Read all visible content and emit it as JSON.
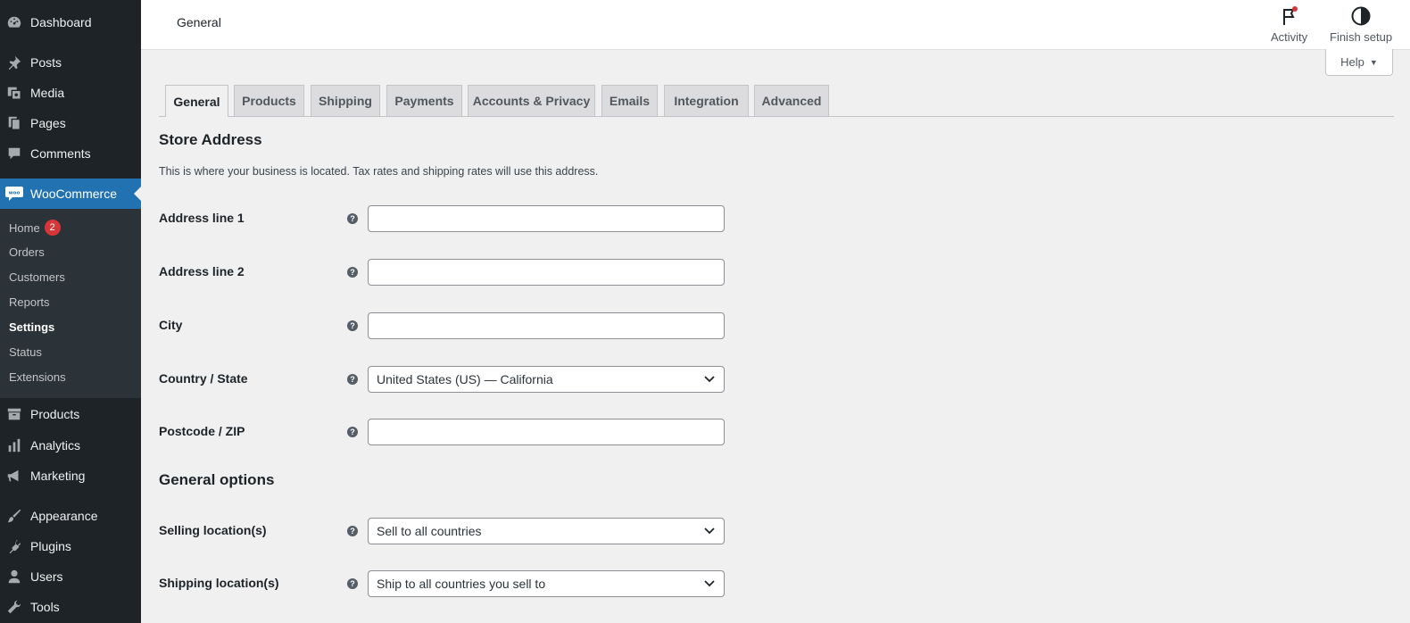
{
  "sidebar": {
    "items": [
      {
        "label": "Dashboard",
        "icon": "dashboard-icon"
      },
      {
        "label": "Posts",
        "icon": "pin-icon"
      },
      {
        "label": "Media",
        "icon": "media-icon"
      },
      {
        "label": "Pages",
        "icon": "pages-icon"
      },
      {
        "label": "Comments",
        "icon": "comment-icon"
      },
      {
        "label": "WooCommerce",
        "icon": "woo-icon"
      },
      {
        "label": "Products",
        "icon": "archive-icon"
      },
      {
        "label": "Analytics",
        "icon": "bar-chart-icon"
      },
      {
        "label": "Marketing",
        "icon": "megaphone-icon"
      },
      {
        "label": "Appearance",
        "icon": "brush-icon"
      },
      {
        "label": "Plugins",
        "icon": "plug-icon"
      },
      {
        "label": "Users",
        "icon": "user-icon"
      },
      {
        "label": "Tools",
        "icon": "wrench-icon"
      }
    ],
    "woo_submenu": [
      {
        "label": "Home",
        "badge": "2"
      },
      {
        "label": "Orders"
      },
      {
        "label": "Customers"
      },
      {
        "label": "Reports"
      },
      {
        "label": "Settings"
      },
      {
        "label": "Status"
      },
      {
        "label": "Extensions"
      }
    ]
  },
  "header": {
    "title": "General",
    "activity_label": "Activity",
    "finish_setup_label": "Finish setup",
    "help_label": "Help"
  },
  "tabs": [
    "General",
    "Products",
    "Shipping",
    "Payments",
    "Accounts & Privacy",
    "Emails",
    "Integration",
    "Advanced"
  ],
  "store_address": {
    "title": "Store Address",
    "description": "This is where your business is located. Tax rates and shipping rates will use this address.",
    "fields": [
      {
        "label": "Address line 1",
        "value": ""
      },
      {
        "label": "Address line 2",
        "value": ""
      },
      {
        "label": "City",
        "value": ""
      },
      {
        "label": "Country / State",
        "value": "United States (US) — California"
      },
      {
        "label": "Postcode / ZIP",
        "value": ""
      }
    ]
  },
  "general_options": {
    "title": "General options",
    "fields": [
      {
        "label": "Selling location(s)",
        "value": "Sell to all countries"
      },
      {
        "label": "Shipping location(s)",
        "value": "Ship to all countries you sell to"
      }
    ]
  },
  "help_tip_glyph": "?",
  "colors": {
    "sidebar_bg": "#1d2327",
    "active_menu": "#2271b1",
    "badge": "#d63638"
  }
}
